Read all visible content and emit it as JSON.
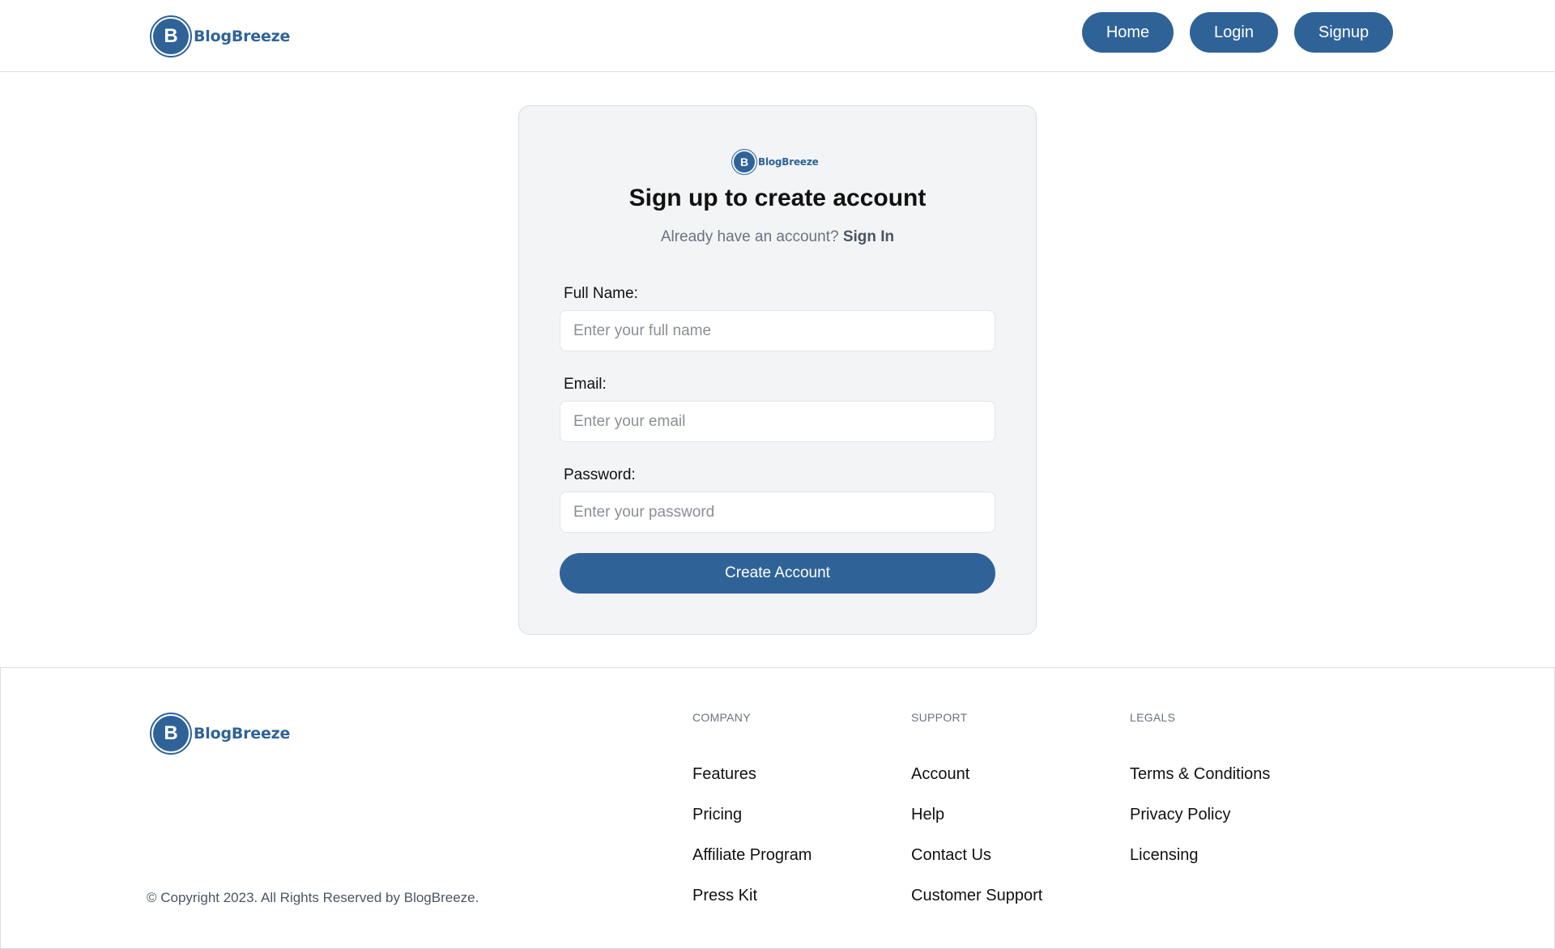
{
  "brand": {
    "name": "BlogBreeze",
    "initial": "B",
    "color": "#2f6398"
  },
  "nav": {
    "home": "Home",
    "login": "Login",
    "signup": "Signup"
  },
  "signup": {
    "title": "Sign up to create account",
    "subtitle": "Already have an account?",
    "signin_link": "Sign In",
    "fields": {
      "full_name": {
        "label": "Full Name:",
        "placeholder": "Enter your full name",
        "value": ""
      },
      "email": {
        "label": "Email:",
        "placeholder": "Enter your email",
        "value": ""
      },
      "password": {
        "label": "Password:",
        "placeholder": "Enter your password",
        "value": ""
      }
    },
    "submit_label": "Create Account"
  },
  "footer": {
    "columns": [
      {
        "heading": "COMPANY",
        "links": [
          "Features",
          "Pricing",
          "Affiliate Program",
          "Press Kit"
        ]
      },
      {
        "heading": "SUPPORT",
        "links": [
          "Account",
          "Help",
          "Contact Us",
          "Customer Support"
        ]
      },
      {
        "heading": "LEGALS",
        "links": [
          "Terms & Conditions",
          "Privacy Policy",
          "Licensing"
        ]
      }
    ],
    "copyright": "© Copyright 2023. All Rights Reserved by BlogBreeze."
  }
}
